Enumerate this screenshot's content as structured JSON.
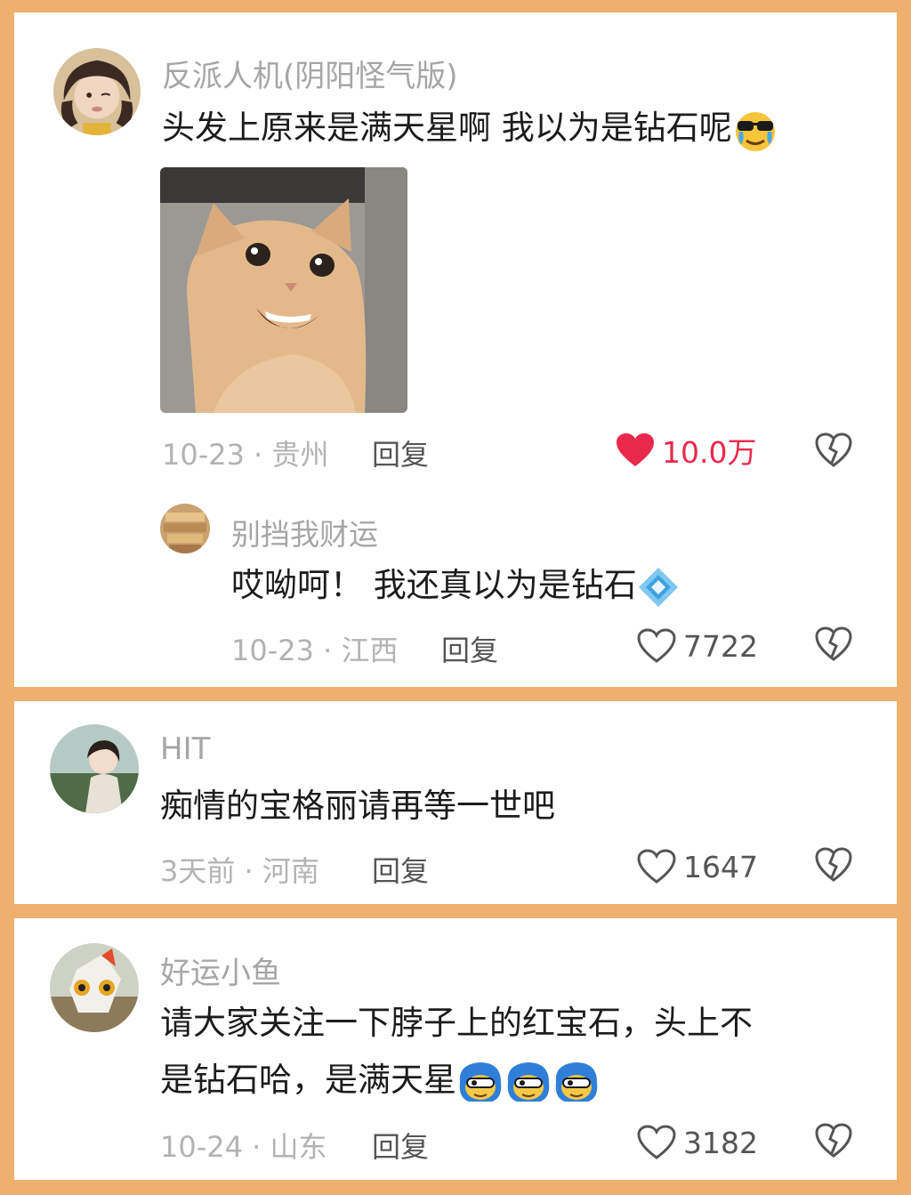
{
  "comments": [
    {
      "username": "反派人机(阴阳怪气版)",
      "text": "头发上原来是满天星啊 我以为是钻石呢",
      "emoji": "sunglasses-crying-emoji",
      "image": "smiling-cat-photo",
      "meta": "10-23 · 贵州",
      "reply": "回复",
      "likes": "10.0万",
      "liked": true,
      "like_color": "#e8294b",
      "replies": [
        {
          "username": "别挡我财运",
          "text": "哎呦呵！ 我还真以为是钻石",
          "emoji": "diamond-emoji",
          "meta": "10-23 · 江西",
          "reply": "回复",
          "likes": "7722"
        }
      ]
    },
    {
      "username": "HIT",
      "text": "痴情的宝格丽请再等一世吧",
      "meta": "3天前 · 河南",
      "reply": "回复",
      "likes": "1647"
    },
    {
      "username": "好运小鱼",
      "text_line1": "请大家关注一下脖子上的红宝石，头上不",
      "text_line2": "是钻石哈，是满天星",
      "emoji": "blue-hair-face-emoji",
      "meta": "10-24 · 山东",
      "reply": "回复",
      "likes": "3182"
    }
  ],
  "colors": {
    "background": "#efb06d",
    "card": "#ffffff",
    "username": "#a6a6a6",
    "text": "#1c1c1c",
    "like_active": "#e8294b"
  }
}
